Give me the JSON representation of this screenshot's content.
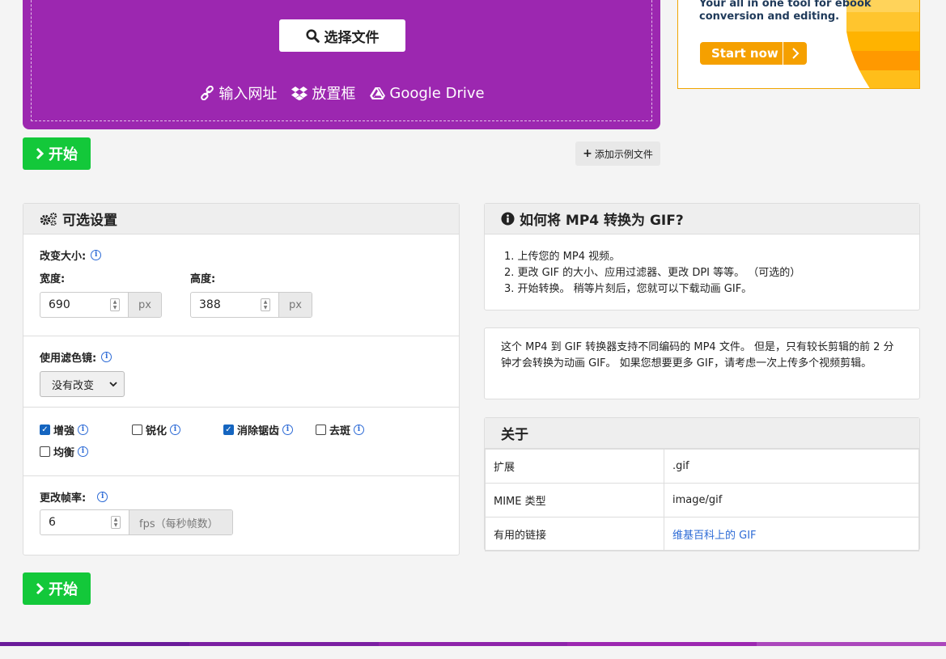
{
  "upload": {
    "choose_label": "选择文件",
    "sources": [
      {
        "icon": "link-icon",
        "label": "输入网址"
      },
      {
        "icon": "dropbox-icon",
        "label": "放置框"
      },
      {
        "icon": "google-drive-icon",
        "label": "Google Drive"
      }
    ]
  },
  "ad": {
    "line1": "Your all in one tool for ebook",
    "line2": "conversion and editing.",
    "cta": "Start now"
  },
  "actions": {
    "start_label": "开始",
    "add_sample_label": "添加示例文件"
  },
  "settings": {
    "title": "可选设置",
    "resize_label": "改变大小:",
    "width_label": "宽度:",
    "width_value": "690",
    "height_label": "高度:",
    "height_value": "388",
    "unit_px": "px",
    "filter_label": "使用滤色镜:",
    "filter_value": "没有改变",
    "options": [
      {
        "label": "增強",
        "checked": true
      },
      {
        "label": "锐化",
        "checked": false
      },
      {
        "label": "消除锯齿",
        "checked": true
      },
      {
        "label": "去斑",
        "checked": false
      },
      {
        "label": "均衡",
        "checked": false
      }
    ],
    "fps_label": "更改帧率:",
    "fps_value": "6",
    "fps_unit": "fps（每秒帧数）"
  },
  "howto": {
    "title": "如何将 MP4 转换为 GIF?",
    "steps": [
      "1. 上传您的 MP4 视频。",
      "2. 更改 GIF 的大小、应用过滤器、更改 DPI 等等。 （可选的）",
      "3. 开始转换。 稍等片刻后，您就可以下载动画 GIF。"
    ]
  },
  "note": {
    "text": "这个 MP4 到 GIF 转换器支持不同编码的 MP4 文件。 但是，只有较长剪辑的前 2 分钟才会转换为动画 GIF。 如果您想要更多 GIF，请考虑一次上传多个视频剪辑。"
  },
  "about": {
    "title": "关于",
    "rows": [
      {
        "key": "扩展",
        "value": ".gif"
      },
      {
        "key": "MIME 类型",
        "value": "image/gif"
      },
      {
        "key": "有用的链接",
        "value": "维基百科上的 GIF"
      }
    ]
  },
  "colors": {
    "upload_bg": "#9c27b0",
    "start_bg": "#13c83a",
    "link": "#2d6bd6"
  }
}
